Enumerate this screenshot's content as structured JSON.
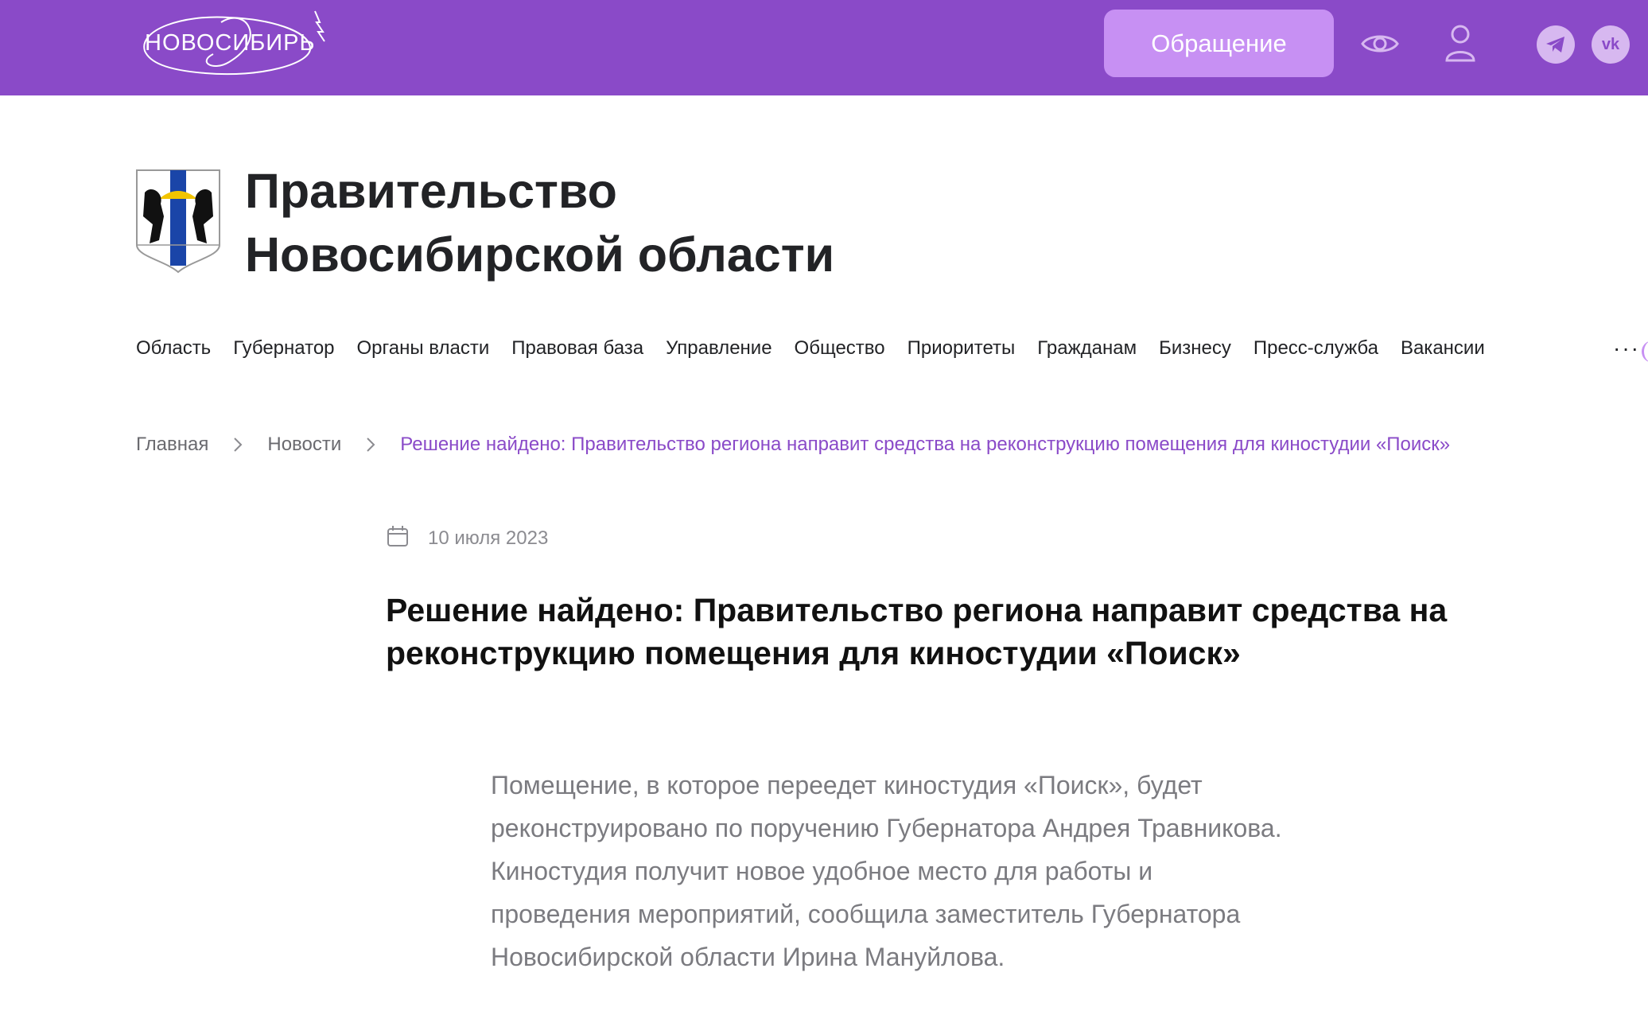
{
  "header": {
    "logo_text": "НОВОСИБИРЬ",
    "appeal_button": "Обращение",
    "icons": {
      "accessibility": "eye-icon",
      "account": "user-icon",
      "telegram": "telegram-icon",
      "vk": "vk-icon"
    },
    "vk_label": "vk",
    "colors": {
      "bar": "#8a4ac8",
      "button": "#c790f3",
      "social": "#d7b8f0"
    }
  },
  "site": {
    "title_line1": "Правительство",
    "title_line2": "Новосибирской области"
  },
  "nav": {
    "items": [
      "Область",
      "Губернатор",
      "Органы власти",
      "Правовая база",
      "Управление",
      "Общество",
      "Приоритеты",
      "Гражданам",
      "Бизнесу",
      "Пресс-служба",
      "Вакансии"
    ],
    "more": "···"
  },
  "breadcrumb": {
    "home": "Главная",
    "section": "Новости",
    "current": "Решение найдено: Правительство региона направит средства на реконструкцию помещения для киностудии «Поиск»"
  },
  "article": {
    "date": "10 июля 2023",
    "title": "Решение найдено: Правительство региона направит средства на реконструкцию помещения для киностудии «Поиск»",
    "lead": "Помещение, в которое переедет киностудия «Поиск», будет реконструировано по поручению Губернатора Андрея Травникова. Киностудия получит новое удобное место для работы и проведения мероприятий, сообщила заместитель Губернатора Новосибирской области Ирина Мануйлова."
  }
}
